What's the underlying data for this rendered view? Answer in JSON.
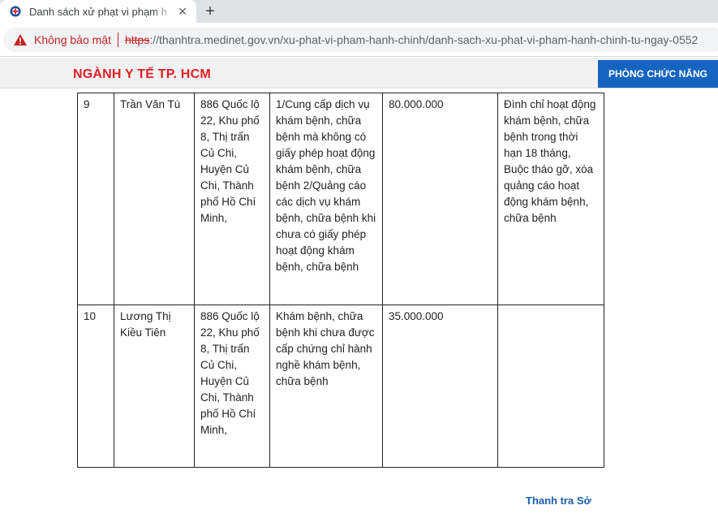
{
  "browser": {
    "tab_title": "Danh sách xử phạt vi phạm h",
    "url_scheme": "https",
    "url_rest": "://thanhtra.medinet.gov.vn/xu-phat-vi-pham-hanh-chinh/danh-sach-xu-phat-vi-pham-hanh-chinh-tu-ngay-0552",
    "security_label": "Không bảo mật",
    "close_symbol": "✕",
    "newtab_symbol": "+"
  },
  "header": {
    "brand": "NGÀNH Y TẾ TP. HCM",
    "menu_button": "PHÒNG CHỨC NĂNG"
  },
  "table": {
    "rows": [
      {
        "stt": "9",
        "name": "Trần Văn Tú",
        "address": "886 Quốc lộ 22, Khu phố 8, Thị trấn Củ Chi, Huyện Củ Chi, Thành phố Hồ Chí Minh,",
        "violation": "1/Cung cấp dịch vụ khám bệnh, chữa bệnh mà không có giấy phép hoạt động khám bệnh, chữa bệnh 2/Quảng cáo các dịch vụ khám bệnh, chữa bệnh khi chưa có giấy phép hoạt động khám bệnh, chữa bệnh",
        "fine": "80.000.000",
        "other": "",
        "remedy": "Đình chỉ hoạt động khám bệnh, chữa bệnh trong thời hạn 18 tháng, Buộc tháo gỡ, xóa quảng cáo hoạt động khám bệnh, chữa bệnh"
      },
      {
        "stt": "10",
        "name": "Lương Thị Kiều Tiên",
        "address": "886 Quốc lộ 22, Khu phố 8, Thị trấn Củ Chi, Huyện Củ Chi, Thành phố Hồ Chí Minh,",
        "violation": "Khám bệnh, chữa bệnh khi chưa được cấp chứng chỉ hành nghề khám bệnh, chữa bệnh",
        "fine": "35.000.000",
        "other": "",
        "remedy": ""
      }
    ]
  },
  "footer": {
    "link": "Thanh tra Sở"
  },
  "colors": {
    "brand_red": "#e31e24",
    "menu_blue": "#1565c0",
    "link_blue": "#1a5ea8",
    "insecure_red": "#c5221f"
  }
}
